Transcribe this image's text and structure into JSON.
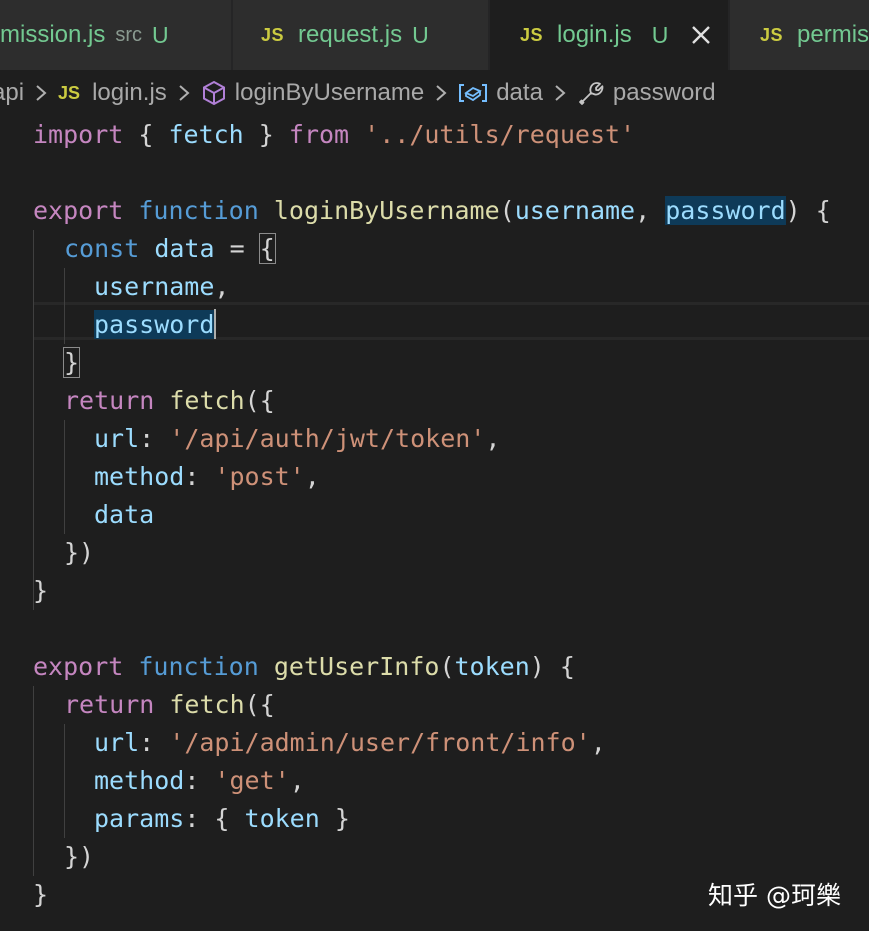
{
  "tabs": [
    {
      "label": "mission.js",
      "desc": "src",
      "status": "U",
      "active": false
    },
    {
      "label": "request.js",
      "desc": "",
      "status": "U",
      "active": false
    },
    {
      "label": "login.js",
      "desc": "",
      "status": "U",
      "active": true
    },
    {
      "label": "permis",
      "desc": "",
      "status": "",
      "active": false
    }
  ],
  "tab_icon_text": "JS",
  "breadcrumb": {
    "folder": "api",
    "file": "login.js",
    "function": "loginByUsername",
    "variable": "data",
    "property": "password"
  },
  "code": {
    "l1": {
      "import": "import",
      "open": " { ",
      "fetch": "fetch",
      "close": " } ",
      "from": "from",
      "path": "'../utils/request'"
    },
    "l3": {
      "export": "export",
      "function": "function",
      "name": "loginByUsername",
      "open": "(",
      "p1": "username",
      "comma": ", ",
      "p2": "password",
      "close": ") {"
    },
    "l4": {
      "const": "const",
      "data": "data",
      "eq": " = ",
      "brace": "{"
    },
    "l5": {
      "username": "username",
      "comma": ","
    },
    "l6": {
      "password": "password"
    },
    "l7": {
      "brace": "}"
    },
    "l8": {
      "return": "return",
      "fetch": "fetch",
      "open": "({"
    },
    "l9": {
      "key": "url",
      "colon": ": ",
      "value": "'/api/auth/jwt/token'",
      "comma": ","
    },
    "l10": {
      "key": "method",
      "colon": ": ",
      "value": "'post'",
      "comma": ","
    },
    "l11": {
      "key": "data"
    },
    "l12": {
      "close": "})"
    },
    "l13": {
      "close": "}"
    },
    "l15": {
      "export": "export",
      "function": "function",
      "name": "getUserInfo",
      "open": "(",
      "p1": "token",
      "close": ") {"
    },
    "l16": {
      "return": "return",
      "fetch": "fetch",
      "open": "({"
    },
    "l17": {
      "key": "url",
      "colon": ": ",
      "value": "'/api/admin/user/front/info'",
      "comma": ","
    },
    "l18": {
      "key": "method",
      "colon": ": ",
      "value": "'get'",
      "comma": ","
    },
    "l19": {
      "key": "params",
      "colon": ": ",
      "open": "{ ",
      "token": "token",
      "close": " }"
    },
    "l20": {
      "close": "})"
    },
    "l21": {
      "close": "}"
    }
  },
  "watermark": "知乎 @珂樂",
  "colors": {
    "background": "#1e1e1e",
    "tab_inactive": "#2d2d2d",
    "keyword_purple": "#c586c0",
    "keyword_blue": "#569cd6",
    "function_yellow": "#dcdcaa",
    "variable_blue": "#9cdcfe",
    "string_orange": "#ce9178",
    "js_icon_yellow": "#cbcb41",
    "untracked_green": "#73c991",
    "highlight": "#0e3a58"
  }
}
